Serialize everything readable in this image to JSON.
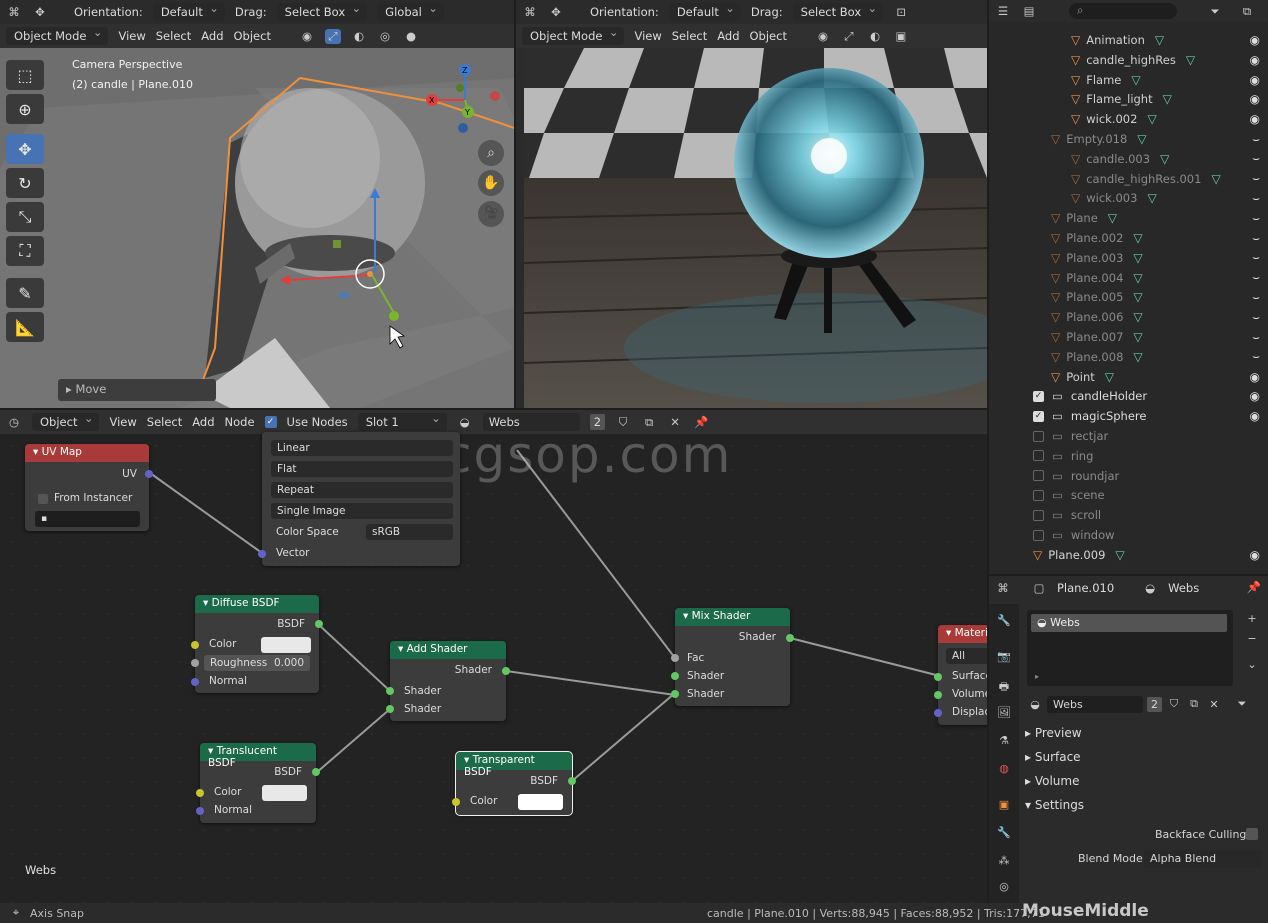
{
  "viewport_left": {
    "header": {
      "orientation_label": "Orientation:",
      "orientation_value": "Default",
      "drag_label": "Drag:",
      "drag_value": "Select Box",
      "transform_space": "Global"
    },
    "menu": {
      "mode": "Object Mode",
      "items": [
        "View",
        "Select",
        "Add",
        "Object"
      ]
    },
    "overlay_line1": "Camera Perspective",
    "overlay_line2": "(2) candle | Plane.010",
    "last_op": "Move"
  },
  "viewport_right": {
    "header": {
      "orientation_label": "Orientation:",
      "orientation_value": "Default",
      "drag_label": "Drag:",
      "drag_value": "Select Box"
    },
    "menu": {
      "mode": "Object Mode",
      "items": [
        "View",
        "Select",
        "Add",
        "Object"
      ]
    }
  },
  "outliner": {
    "rows": [
      {
        "label": "Animation",
        "color": "#d0d0d0",
        "indent": 1,
        "dim": false
      },
      {
        "label": "candle_highRes",
        "color": "#d0d0d0",
        "indent": 1,
        "dim": false
      },
      {
        "label": "Flame",
        "color": "#d0d0d0",
        "indent": 1,
        "dim": false
      },
      {
        "label": "Flame_light",
        "color": "#d0d0d0",
        "indent": 1,
        "dim": false
      },
      {
        "label": "wick.002",
        "color": "#d0d0d0",
        "indent": 1,
        "dim": false
      },
      {
        "label": "Empty.018",
        "color": "#8a8a8a",
        "indent": 0,
        "dim": true
      },
      {
        "label": "candle.003",
        "color": "#8a8a8a",
        "indent": 1,
        "dim": true
      },
      {
        "label": "candle_highRes.001",
        "color": "#8a8a8a",
        "indent": 1,
        "dim": true
      },
      {
        "label": "wick.003",
        "color": "#8a8a8a",
        "indent": 1,
        "dim": true
      },
      {
        "label": "Plane",
        "color": "#8a8a8a",
        "indent": 0,
        "dim": true
      },
      {
        "label": "Plane.002",
        "color": "#8a8a8a",
        "indent": 0,
        "dim": true
      },
      {
        "label": "Plane.003",
        "color": "#8a8a8a",
        "indent": 0,
        "dim": true
      },
      {
        "label": "Plane.004",
        "color": "#8a8a8a",
        "indent": 0,
        "dim": true
      },
      {
        "label": "Plane.005",
        "color": "#8a8a8a",
        "indent": 0,
        "dim": true
      },
      {
        "label": "Plane.006",
        "color": "#8a8a8a",
        "indent": 0,
        "dim": true
      },
      {
        "label": "Plane.007",
        "color": "#8a8a8a",
        "indent": 0,
        "dim": true
      },
      {
        "label": "Plane.008",
        "color": "#8a8a8a",
        "indent": 0,
        "dim": true
      },
      {
        "label": "Point",
        "color": "#d0d0d0",
        "indent": 0,
        "dim": false
      }
    ],
    "collections": [
      {
        "label": "candleHolder",
        "checked": true
      },
      {
        "label": "magicSphere",
        "checked": true
      },
      {
        "label": "rectjar",
        "checked": false
      },
      {
        "label": "ring",
        "checked": false
      },
      {
        "label": "roundjar",
        "checked": false
      },
      {
        "label": "scene",
        "checked": false
      },
      {
        "label": "scroll",
        "checked": false
      },
      {
        "label": "window",
        "checked": false
      }
    ],
    "last_row": "Plane.009"
  },
  "node_editor": {
    "header": {
      "type": "Object",
      "items": [
        "View",
        "Select",
        "Add",
        "Node"
      ],
      "use_nodes": "Use Nodes",
      "slot": "Slot 1",
      "material": "Webs",
      "users": "2"
    },
    "watermark": "cgsop.com",
    "footer_label": "Webs",
    "image_node": {
      "interp": "Linear",
      "proj": "Flat",
      "ext": "Repeat",
      "source": "Single Image",
      "color_space_label": "Color Space",
      "color_space": "sRGB",
      "vector": "Vector"
    },
    "uv_map": {
      "title": "UV Map",
      "out": "UV",
      "from_instancer": "From Instancer",
      "field": "▪"
    },
    "diffuse": {
      "title": "Diffuse BSDF",
      "out": "BSDF",
      "color": "Color",
      "roughness": "Roughness",
      "roughness_val": "0.000",
      "normal": "Normal"
    },
    "translucent": {
      "title": "Translucent BSDF",
      "out": "BSDF",
      "color": "Color",
      "normal": "Normal"
    },
    "add_shader": {
      "title": "Add Shader",
      "out": "Shader",
      "in1": "Shader",
      "in2": "Shader"
    },
    "transparent": {
      "title": "Transparent BSDF",
      "out": "BSDF",
      "color": "Color"
    },
    "mix_shader": {
      "title": "Mix Shader",
      "out": "Shader",
      "fac": "Fac",
      "in1": "Shader",
      "in2": "Shader"
    },
    "material_output": {
      "title": "Materi",
      "target": "All",
      "surface": "Surface",
      "volume": "Volume",
      "displace": "Displac"
    }
  },
  "properties": {
    "header_object": "Plane.010",
    "header_material": "Webs",
    "slot_item": "Webs",
    "material_name": "Webs",
    "users": "2",
    "sections": [
      "Preview",
      "Surface",
      "Volume",
      "Settings"
    ],
    "backface_label": "Backface Culling",
    "blend_label": "Blend Mode",
    "blend_value": "Alpha Blend"
  },
  "statusbar": {
    "left": "Axis Snap",
    "right": "candle | Plane.010 | Verts:88,945 | Faces:88,952 | Tris:177,71",
    "overlay": "MouseMiddle"
  },
  "colors": {
    "accent": "#4772b3",
    "orange": "#f0903c",
    "node_shader": "#1b6b4b",
    "node_input": "#a83a3a"
  }
}
